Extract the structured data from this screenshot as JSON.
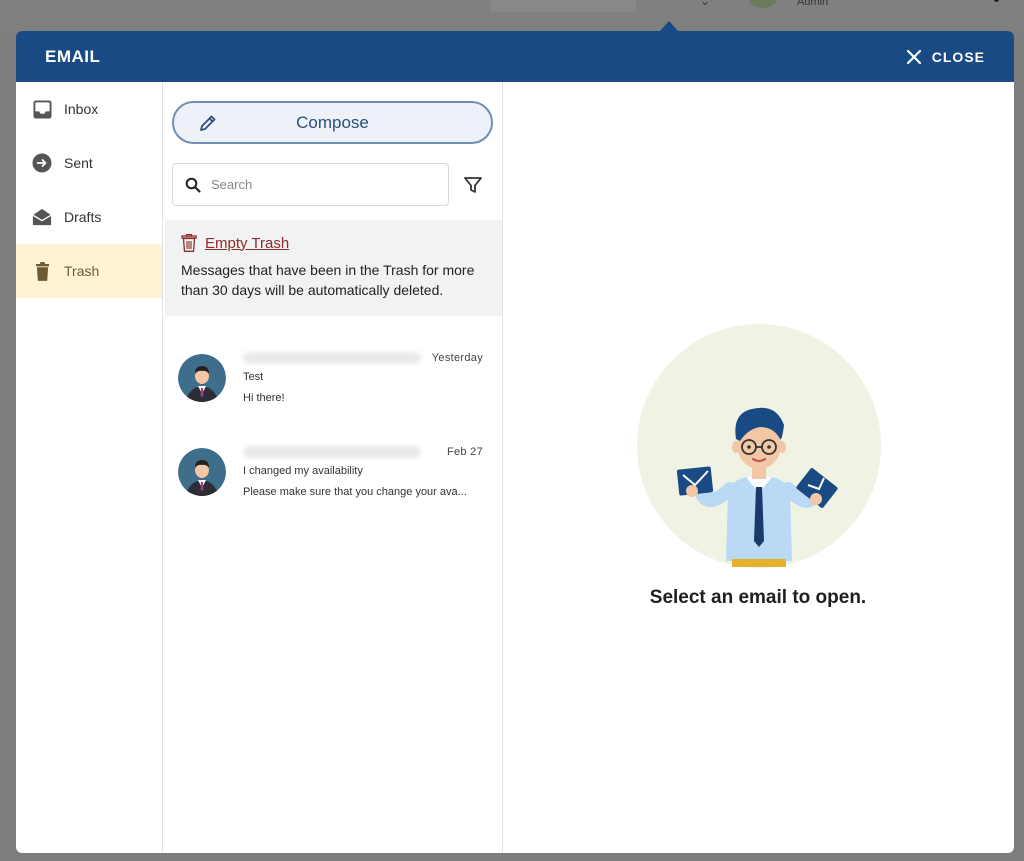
{
  "topbar": {
    "user_role": "Admin"
  },
  "modal": {
    "title": "EMAIL",
    "close_label": "CLOSE"
  },
  "folders": [
    {
      "label": "Inbox",
      "icon": "inbox-icon",
      "active": false
    },
    {
      "label": "Sent",
      "icon": "sent-icon",
      "active": false
    },
    {
      "label": "Drafts",
      "icon": "drafts-icon",
      "active": false
    },
    {
      "label": "Trash",
      "icon": "trash-icon",
      "active": true
    }
  ],
  "compose": {
    "label": "Compose"
  },
  "search": {
    "placeholder": "Search",
    "value": ""
  },
  "trash_notice": {
    "action_label": "Empty Trash",
    "message": "Messages that have been in the Trash for more than 30 days will be automatically deleted."
  },
  "messages": [
    {
      "date": "Yesterday",
      "subject": "Test",
      "preview": "Hi there!"
    },
    {
      "date": "Feb 27",
      "subject": "I changed my availability",
      "preview": "Please make sure that you change your ava..."
    }
  ],
  "reader": {
    "empty_text": "Select an email to open."
  },
  "colors": {
    "header": "#1a4a84",
    "active_folder_bg": "#fff3d6",
    "danger": "#8b2c2c",
    "illustration_bg": "#f0f3e4"
  }
}
